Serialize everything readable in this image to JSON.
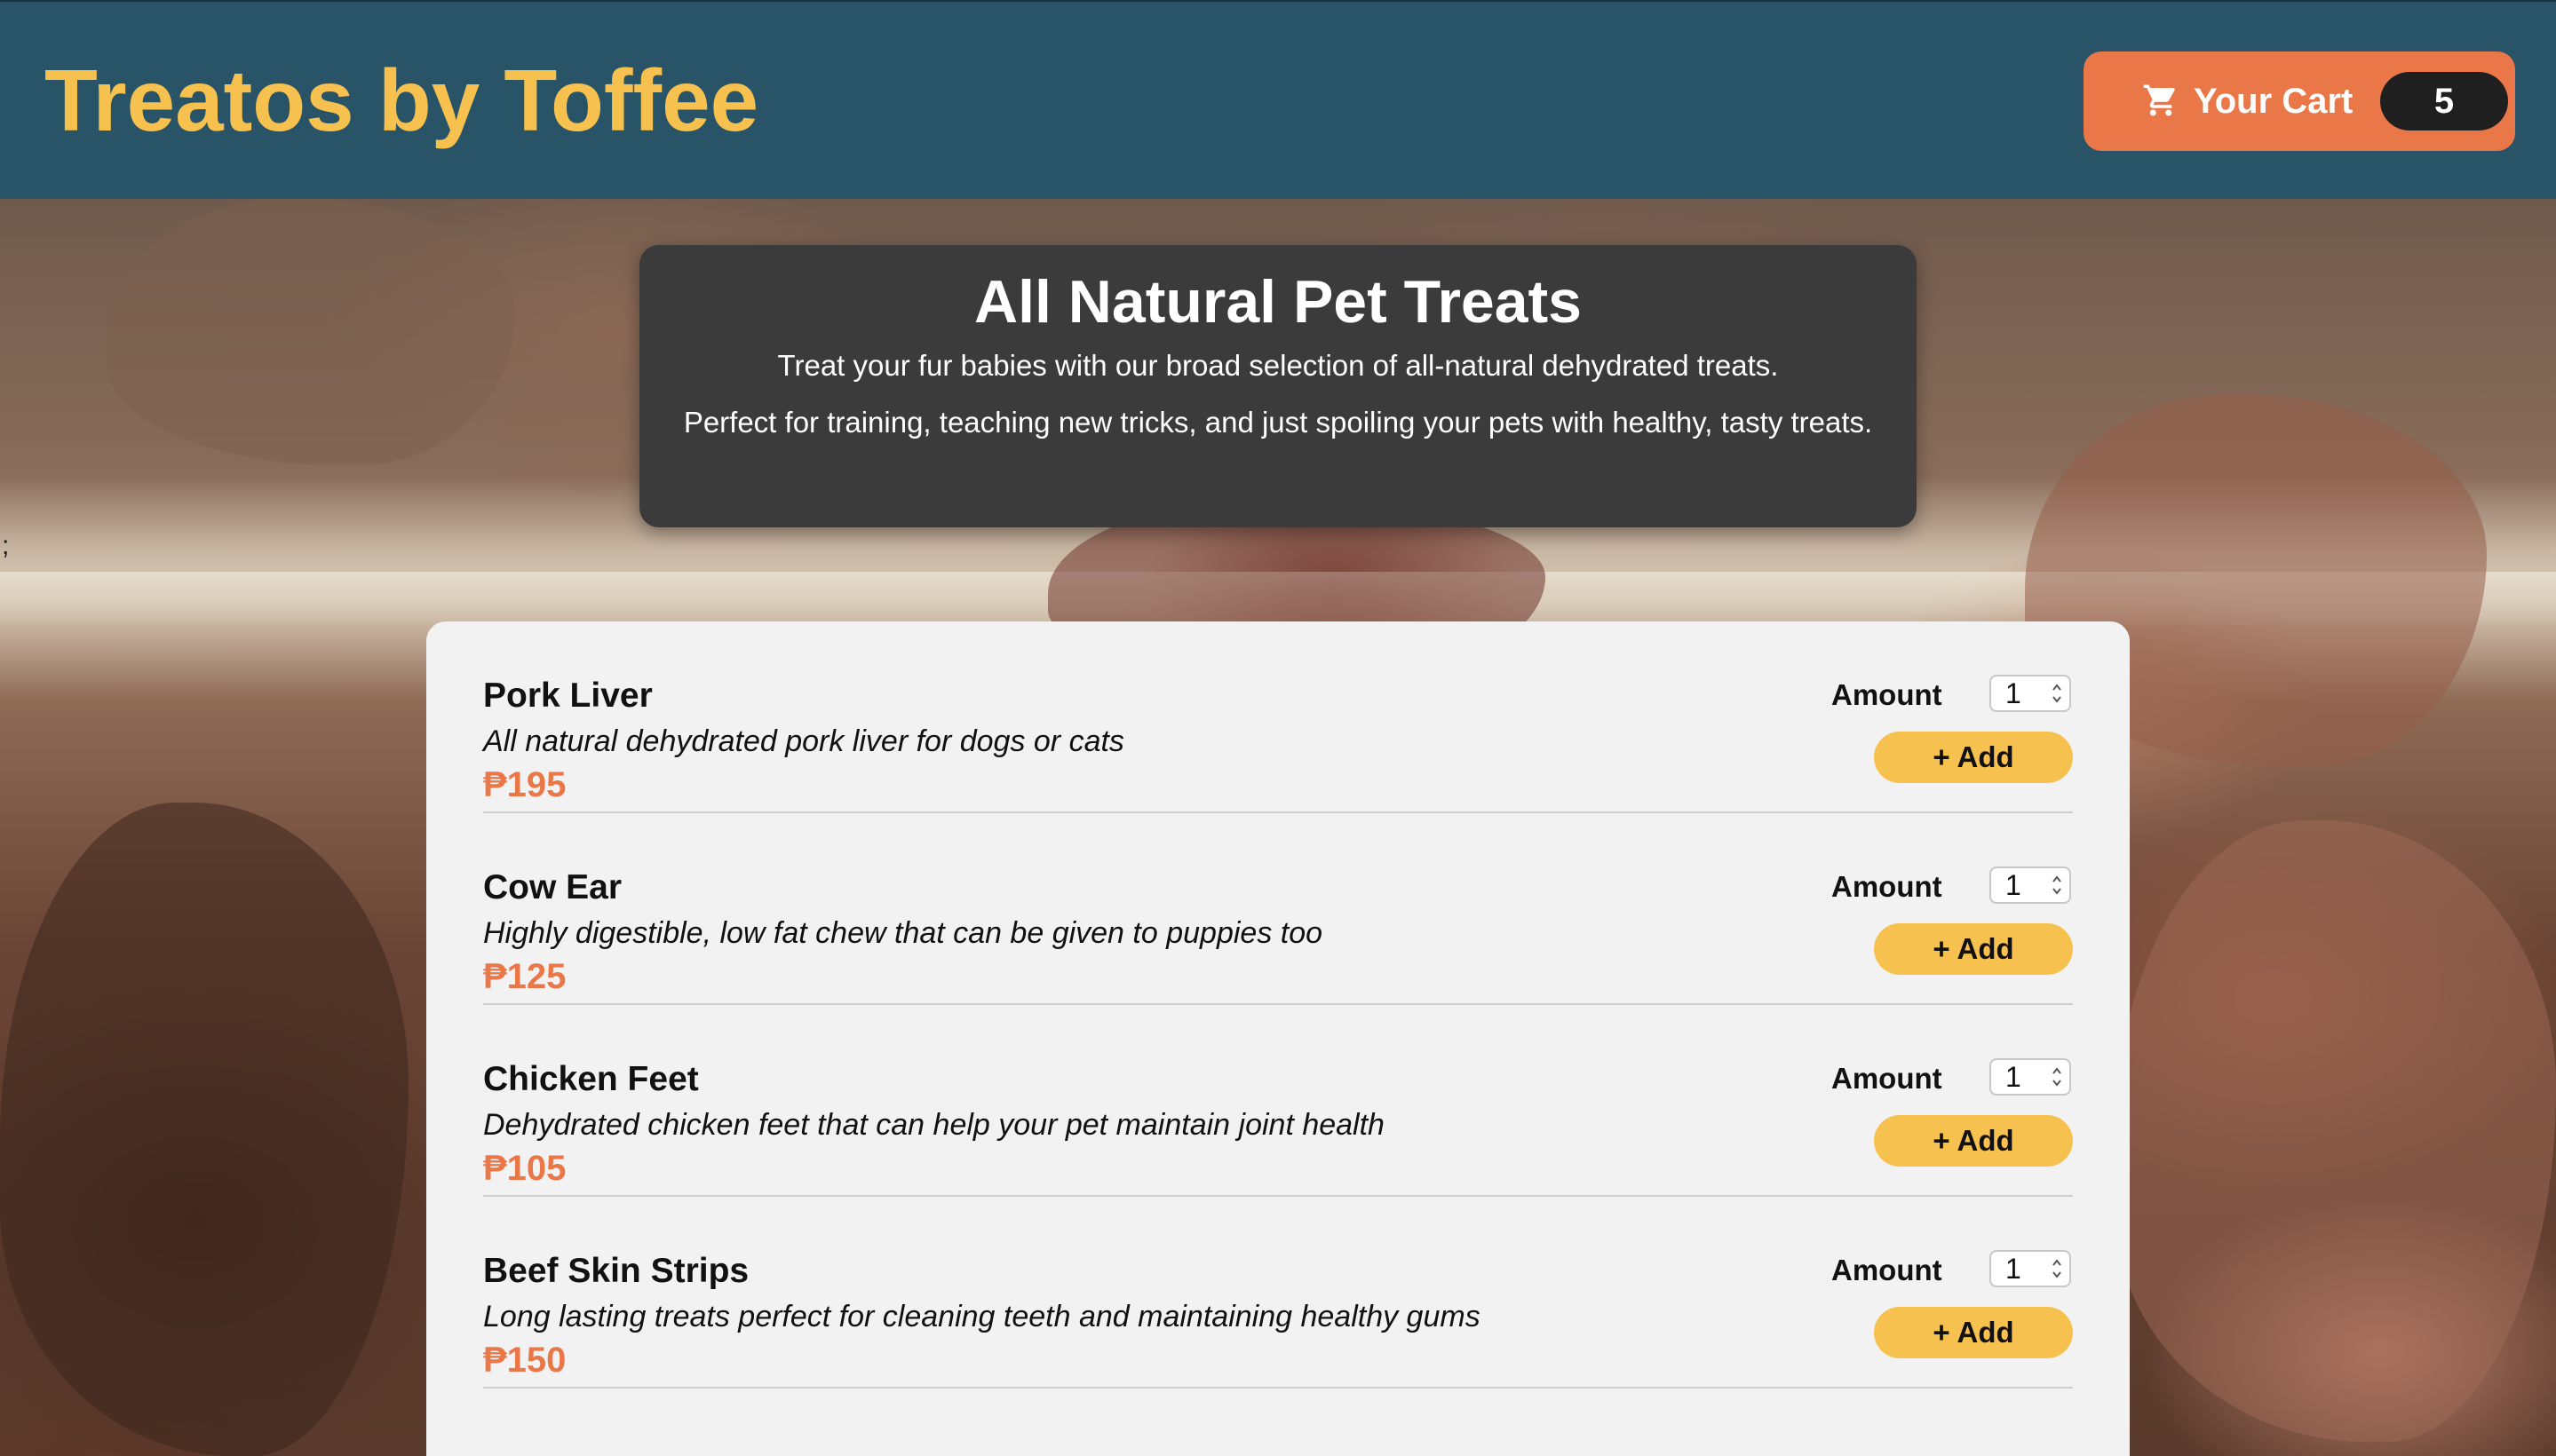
{
  "header": {
    "brand": "Treatos by Toffee",
    "cart": {
      "icon": "cart-icon",
      "label": "Your Cart",
      "count": "5"
    }
  },
  "stray_text": ";",
  "intro": {
    "title": "All Natural Pet Treats",
    "line1": "Treat your fur babies with our broad selection of all-natural dehydrated treats.",
    "line2": "Perfect for training, teaching new tricks, and just spoiling your pets with healthy, tasty treats."
  },
  "meals": [
    {
      "name": "Pork Liver",
      "description": "All natural dehydrated pork liver for dogs or cats",
      "price": "₱195",
      "amount_label": "Amount",
      "amount_value": "1",
      "add_label": "+ Add"
    },
    {
      "name": "Cow Ear",
      "description": "Highly digestible, low fat chew that can be given to puppies too",
      "price": "₱125",
      "amount_label": "Amount",
      "amount_value": "1",
      "add_label": "+ Add"
    },
    {
      "name": "Chicken Feet",
      "description": "Dehydrated chicken feet that can help your pet maintain joint health",
      "price": "₱105",
      "amount_label": "Amount",
      "amount_value": "1",
      "add_label": "+ Add"
    },
    {
      "name": "Beef Skin Strips",
      "description": "Long lasting treats perfect for cleaning teeth and maintaining healthy gums",
      "price": "₱150",
      "amount_label": "Amount",
      "amount_value": "1",
      "add_label": "+ Add"
    }
  ],
  "colors": {
    "header_bg": "#295366",
    "brand": "#f6c14e",
    "cart_button": "#ea7748",
    "price": "#ea7748",
    "add_button": "#f6c14e",
    "intro_bg": "#3b3b3b",
    "menu_bg": "#f2f2f2"
  }
}
